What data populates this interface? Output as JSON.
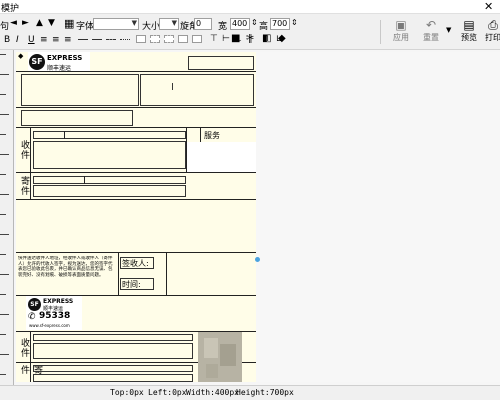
{
  "window": {
    "title": "模护",
    "close_glyph": "✕"
  },
  "toolbar": {
    "nav_left_partial": "句",
    "font_label": "字体",
    "font_value": "",
    "size_label": "大小",
    "size_value": "",
    "rotate_label": "旋角",
    "rotate_value": "0",
    "width_label": "宽",
    "width_value": "400",
    "height_label": "高",
    "height_value": "700",
    "apply_label": "应用",
    "reset_label": "重置",
    "preview_label": "预览",
    "print_label": "打印"
  },
  "waybill": {
    "logo_text": "SF",
    "logo_brand": "EXPRESS",
    "logo_subbrand": "顺丰速运",
    "service_label": "服务",
    "recipient_label": "收件",
    "sender_label": "寄件",
    "notice_text": "快件送达收件人地址，经收件人或收件人（寄件人）允许的代收人签字，视为送达，您的签字代表您已验收此包裹，并已确认商品信息无误、包装完好、没有划痕、破损等表面质量问题。",
    "signer_label": "签收人:",
    "time_label": "时间:",
    "bottom_logo_brand": "EXPRESS",
    "bottom_logo_subbrand": "顺丰速运",
    "hotline": "95338",
    "website": "www.sf-express.com"
  },
  "statusbar": {
    "top": "Top:0px",
    "left": "Left:0px",
    "width": "Width:400px",
    "height": "Height:700px"
  }
}
